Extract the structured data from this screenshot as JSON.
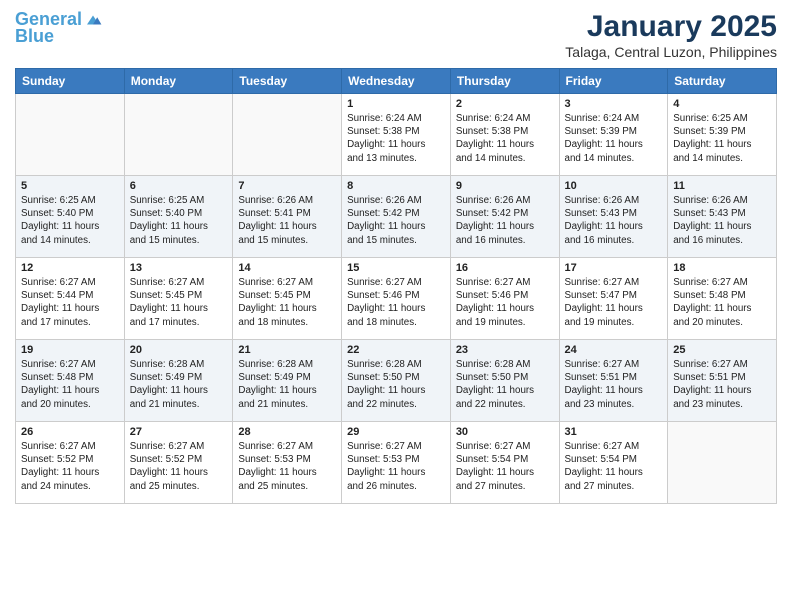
{
  "logo": {
    "text_general_span": "General",
    "text_general": "General",
    "text_blue": "Blue"
  },
  "header": {
    "title": "January 2025",
    "subtitle": "Talaga, Central Luzon, Philippines"
  },
  "calendar": {
    "headers": [
      "Sunday",
      "Monday",
      "Tuesday",
      "Wednesday",
      "Thursday",
      "Friday",
      "Saturday"
    ],
    "weeks": [
      [
        {
          "day": "",
          "info": ""
        },
        {
          "day": "",
          "info": ""
        },
        {
          "day": "",
          "info": ""
        },
        {
          "day": "1",
          "info": "Sunrise: 6:24 AM\nSunset: 5:38 PM\nDaylight: 11 hours\nand 13 minutes."
        },
        {
          "day": "2",
          "info": "Sunrise: 6:24 AM\nSunset: 5:38 PM\nDaylight: 11 hours\nand 14 minutes."
        },
        {
          "day": "3",
          "info": "Sunrise: 6:24 AM\nSunset: 5:39 PM\nDaylight: 11 hours\nand 14 minutes."
        },
        {
          "day": "4",
          "info": "Sunrise: 6:25 AM\nSunset: 5:39 PM\nDaylight: 11 hours\nand 14 minutes."
        }
      ],
      [
        {
          "day": "5",
          "info": "Sunrise: 6:25 AM\nSunset: 5:40 PM\nDaylight: 11 hours\nand 14 minutes."
        },
        {
          "day": "6",
          "info": "Sunrise: 6:25 AM\nSunset: 5:40 PM\nDaylight: 11 hours\nand 15 minutes."
        },
        {
          "day": "7",
          "info": "Sunrise: 6:26 AM\nSunset: 5:41 PM\nDaylight: 11 hours\nand 15 minutes."
        },
        {
          "day": "8",
          "info": "Sunrise: 6:26 AM\nSunset: 5:42 PM\nDaylight: 11 hours\nand 15 minutes."
        },
        {
          "day": "9",
          "info": "Sunrise: 6:26 AM\nSunset: 5:42 PM\nDaylight: 11 hours\nand 16 minutes."
        },
        {
          "day": "10",
          "info": "Sunrise: 6:26 AM\nSunset: 5:43 PM\nDaylight: 11 hours\nand 16 minutes."
        },
        {
          "day": "11",
          "info": "Sunrise: 6:26 AM\nSunset: 5:43 PM\nDaylight: 11 hours\nand 16 minutes."
        }
      ],
      [
        {
          "day": "12",
          "info": "Sunrise: 6:27 AM\nSunset: 5:44 PM\nDaylight: 11 hours\nand 17 minutes."
        },
        {
          "day": "13",
          "info": "Sunrise: 6:27 AM\nSunset: 5:45 PM\nDaylight: 11 hours\nand 17 minutes."
        },
        {
          "day": "14",
          "info": "Sunrise: 6:27 AM\nSunset: 5:45 PM\nDaylight: 11 hours\nand 18 minutes."
        },
        {
          "day": "15",
          "info": "Sunrise: 6:27 AM\nSunset: 5:46 PM\nDaylight: 11 hours\nand 18 minutes."
        },
        {
          "day": "16",
          "info": "Sunrise: 6:27 AM\nSunset: 5:46 PM\nDaylight: 11 hours\nand 19 minutes."
        },
        {
          "day": "17",
          "info": "Sunrise: 6:27 AM\nSunset: 5:47 PM\nDaylight: 11 hours\nand 19 minutes."
        },
        {
          "day": "18",
          "info": "Sunrise: 6:27 AM\nSunset: 5:48 PM\nDaylight: 11 hours\nand 20 minutes."
        }
      ],
      [
        {
          "day": "19",
          "info": "Sunrise: 6:27 AM\nSunset: 5:48 PM\nDaylight: 11 hours\nand 20 minutes."
        },
        {
          "day": "20",
          "info": "Sunrise: 6:28 AM\nSunset: 5:49 PM\nDaylight: 11 hours\nand 21 minutes."
        },
        {
          "day": "21",
          "info": "Sunrise: 6:28 AM\nSunset: 5:49 PM\nDaylight: 11 hours\nand 21 minutes."
        },
        {
          "day": "22",
          "info": "Sunrise: 6:28 AM\nSunset: 5:50 PM\nDaylight: 11 hours\nand 22 minutes."
        },
        {
          "day": "23",
          "info": "Sunrise: 6:28 AM\nSunset: 5:50 PM\nDaylight: 11 hours\nand 22 minutes."
        },
        {
          "day": "24",
          "info": "Sunrise: 6:27 AM\nSunset: 5:51 PM\nDaylight: 11 hours\nand 23 minutes."
        },
        {
          "day": "25",
          "info": "Sunrise: 6:27 AM\nSunset: 5:51 PM\nDaylight: 11 hours\nand 23 minutes."
        }
      ],
      [
        {
          "day": "26",
          "info": "Sunrise: 6:27 AM\nSunset: 5:52 PM\nDaylight: 11 hours\nand 24 minutes."
        },
        {
          "day": "27",
          "info": "Sunrise: 6:27 AM\nSunset: 5:52 PM\nDaylight: 11 hours\nand 25 minutes."
        },
        {
          "day": "28",
          "info": "Sunrise: 6:27 AM\nSunset: 5:53 PM\nDaylight: 11 hours\nand 25 minutes."
        },
        {
          "day": "29",
          "info": "Sunrise: 6:27 AM\nSunset: 5:53 PM\nDaylight: 11 hours\nand 26 minutes."
        },
        {
          "day": "30",
          "info": "Sunrise: 6:27 AM\nSunset: 5:54 PM\nDaylight: 11 hours\nand 27 minutes."
        },
        {
          "day": "31",
          "info": "Sunrise: 6:27 AM\nSunset: 5:54 PM\nDaylight: 11 hours\nand 27 minutes."
        },
        {
          "day": "",
          "info": ""
        }
      ]
    ]
  }
}
